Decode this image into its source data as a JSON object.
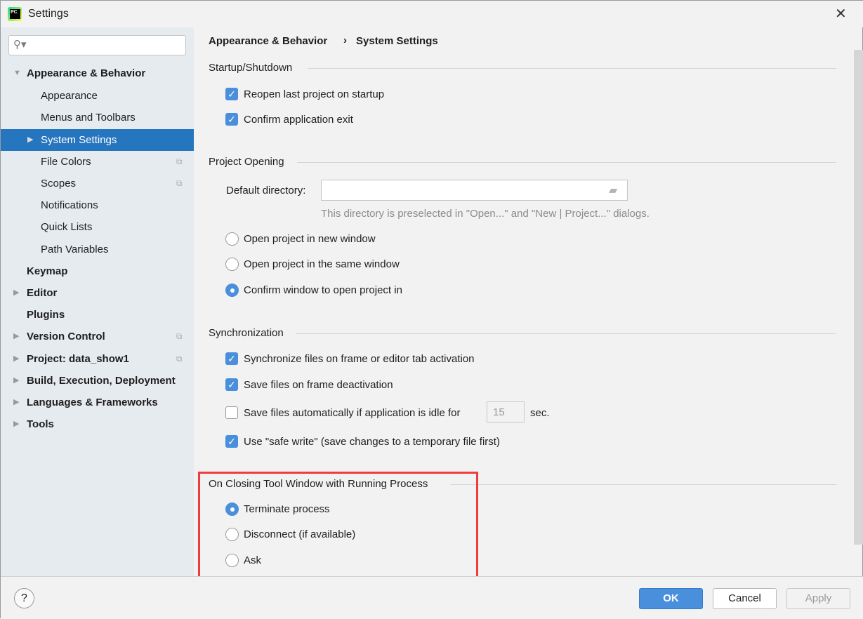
{
  "window": {
    "title": "Settings",
    "close": "✕"
  },
  "search": {
    "placeholder": "",
    "icon": "search-icon"
  },
  "tree": [
    {
      "label": "Appearance & Behavior",
      "bold": true,
      "expanded": true
    },
    {
      "label": "Appearance"
    },
    {
      "label": "Menus and Toolbars"
    },
    {
      "label": "System Settings",
      "selected": true
    },
    {
      "label": "File Colors"
    },
    {
      "label": "Scopes"
    },
    {
      "label": "Notifications"
    },
    {
      "label": "Quick Lists"
    },
    {
      "label": "Path Variables"
    },
    {
      "label": "Keymap",
      "bold": true
    },
    {
      "label": "Editor",
      "bold": true
    },
    {
      "label": "Plugins",
      "bold": true
    },
    {
      "label": "Version Control",
      "bold": true
    },
    {
      "label": "Project: data_show1",
      "bold": true
    },
    {
      "label": "Build, Execution, Deployment",
      "bold": true
    },
    {
      "label": "Languages & Frameworks",
      "bold": true
    },
    {
      "label": "Tools",
      "bold": true
    }
  ],
  "breadcrumb": {
    "parent": "Appearance & Behavior",
    "sep": "›",
    "current": "System Settings"
  },
  "startup": {
    "title": "Startup/Shutdown",
    "reopen": "Reopen last project on startup",
    "confirm_exit": "Confirm application exit"
  },
  "project_opening": {
    "title": "Project Opening",
    "default_dir_label": "Default directory:",
    "default_dir_value": "",
    "hint": "This directory is preselected in \"Open...\" and \"New | Project...\" dialogs.",
    "opt_new": "Open project in new window",
    "opt_same": "Open project in the same window",
    "opt_confirm": "Confirm window to open project in",
    "selected": "Confirm window to open project in"
  },
  "sync": {
    "title": "Synchronization",
    "sync_files": "Synchronize files on frame or editor tab activation",
    "save_deact": "Save files on frame deactivation",
    "save_idle": "Save files automatically if application is idle for",
    "idle_value": "15",
    "idle_unit": "sec.",
    "safe_write": "Use \"safe write\" (save changes to a temporary file first)"
  },
  "closing": {
    "title": "On Closing Tool Window with Running Process",
    "opt_terminate": "Terminate process",
    "opt_disconnect": "Disconnect (if available)",
    "opt_ask": "Ask",
    "selected": "Terminate process",
    "highlight_color": "#f03c3c"
  },
  "footer": {
    "help": "?",
    "ok": "OK",
    "cancel": "Cancel",
    "apply": "Apply"
  }
}
